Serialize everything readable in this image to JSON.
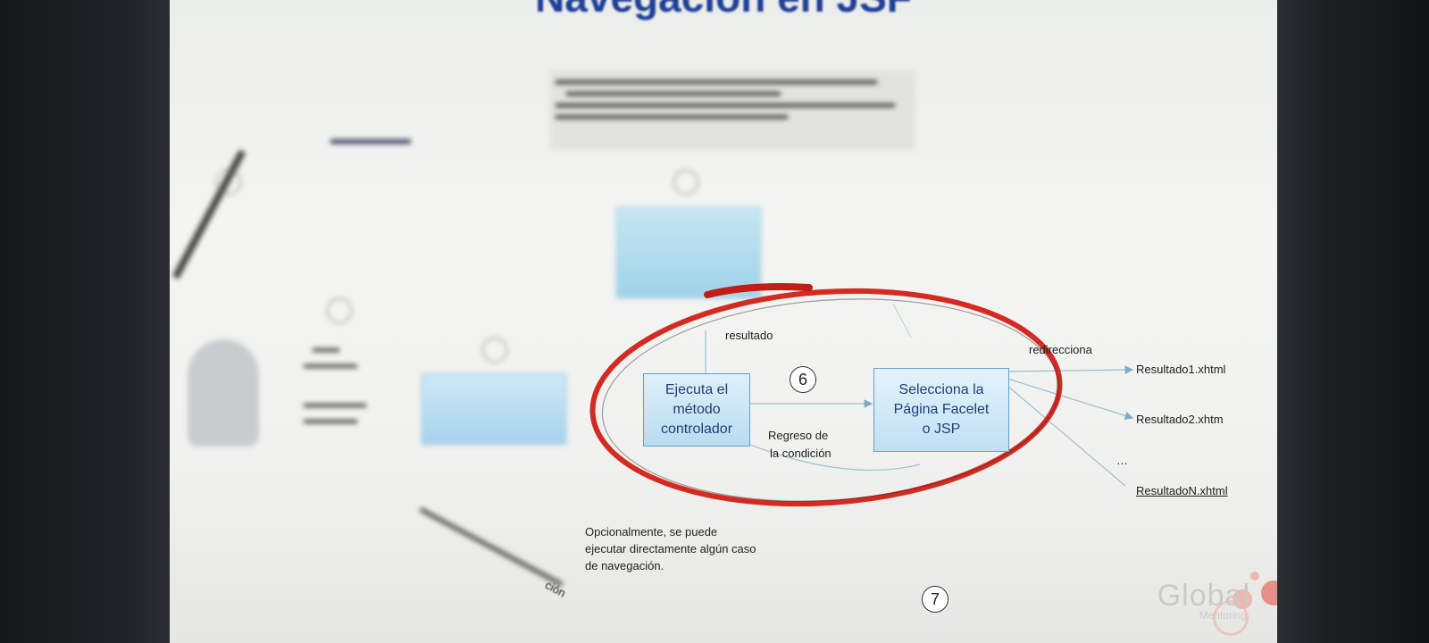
{
  "slide": {
    "title": "Navegación en JSF",
    "boxes": {
      "ejecuta": [
        "Ejecuta el",
        "método",
        "controlador"
      ],
      "selecciona": [
        "Selecciona la",
        "Página Facelet",
        "o JSP"
      ]
    },
    "labels": {
      "resultado": "resultado",
      "redirecciona": "redirecciona",
      "regreso_line1": "Regreso de",
      "regreso_line2": "la condición"
    },
    "outputs": [
      "Resultado1.xhtml",
      "Resultado2.xhtm",
      "…",
      "ResultadoN.xhtml"
    ],
    "step_numbers": {
      "six": "6",
      "seven": "7"
    },
    "note": [
      "Opcionalmente, se puede",
      "ejecutar directamente algún caso",
      "de navegación."
    ],
    "fragment": "ción",
    "logo": {
      "word": "Global",
      "sub": "Mentoring"
    }
  },
  "colors": {
    "title": "#1f3f96",
    "box_border": "#5ba3cf",
    "annotation": "#d42a22"
  }
}
